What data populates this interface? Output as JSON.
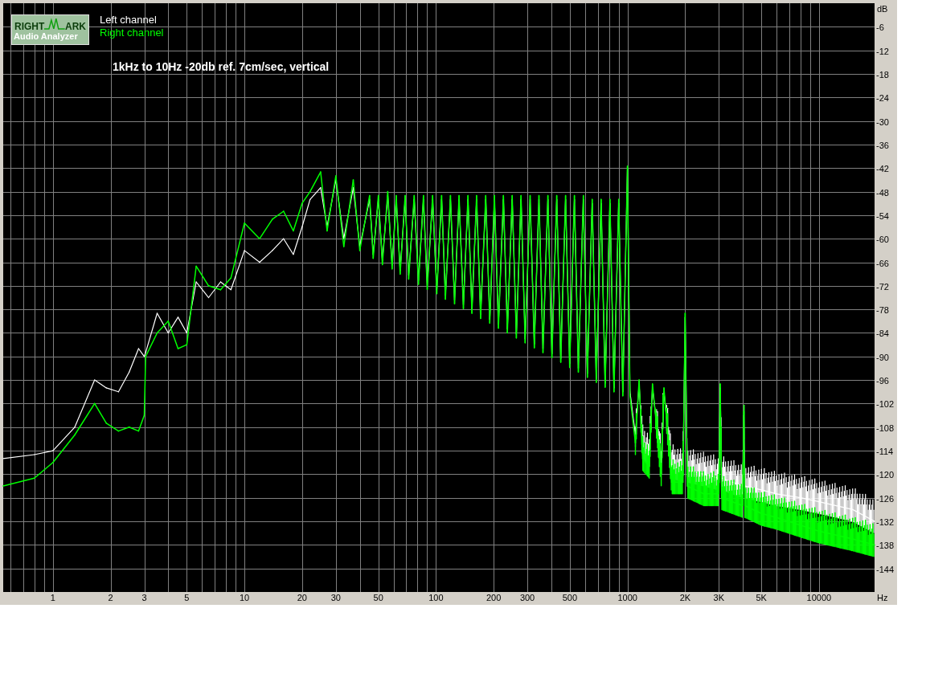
{
  "logo": {
    "text_left": "RIGHT",
    "text_right": "ARK",
    "subtitle": "Audio Analyzer"
  },
  "legend": [
    {
      "label": "Left channel",
      "color": "#ffffff"
    },
    {
      "label": "Right channel",
      "color": "#00ff00"
    }
  ],
  "title": "1kHz to 10Hz -20db ref. 7cm/sec, vertical",
  "y_axis": {
    "unit": "dB",
    "labels": [
      "-6",
      "-12",
      "-18",
      "-24",
      "-30",
      "-36",
      "-42",
      "-48",
      "-54",
      "-60",
      "-66",
      "-72",
      "-78",
      "-84",
      "-90",
      "-96",
      "-102",
      "-108",
      "-114",
      "-120",
      "-126",
      "-132",
      "-138",
      "-144"
    ]
  },
  "x_axis": {
    "unit": "Hz",
    "labels": [
      "1",
      "2",
      "3",
      "5",
      "10",
      "20",
      "30",
      "50",
      "100",
      "200",
      "300",
      "500",
      "1000",
      "2K",
      "3K",
      "5K",
      "10000"
    ]
  }
}
